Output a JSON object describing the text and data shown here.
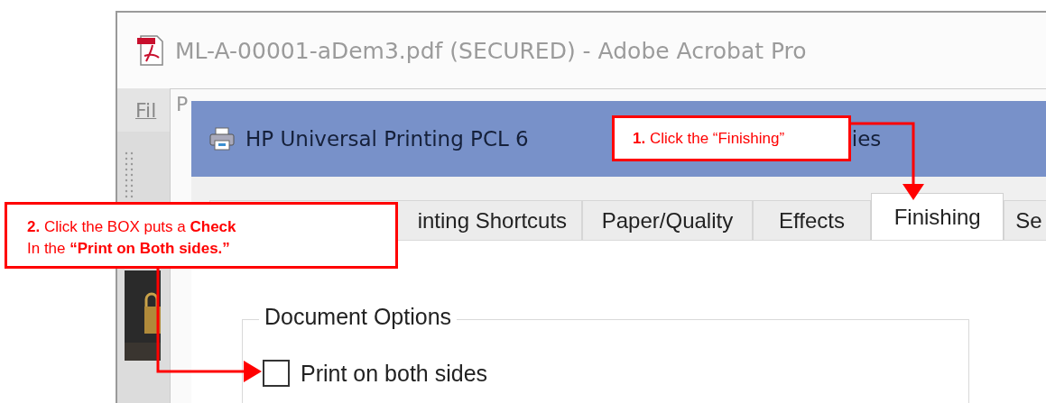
{
  "background_window": {
    "title": "ML-A-00001-aDem3.pdf (SECURED) - Adobe Acrobat Pro",
    "menu": [
      "Fil"
    ]
  },
  "print_window": {
    "title": "P"
  },
  "dialog": {
    "title_parts": [
      "HP Universal Printing PCL 6",
      "ies"
    ],
    "tabs": [
      {
        "label": "inting Shortcuts",
        "selected": false
      },
      {
        "label": "Paper/Quality",
        "selected": false
      },
      {
        "label": "Effects",
        "selected": false
      },
      {
        "label": "Finishing",
        "selected": true
      },
      {
        "label": "Se",
        "selected": false
      }
    ],
    "group": {
      "title": "Document Options",
      "options": [
        {
          "label": "Print on both sides",
          "checked": false
        }
      ]
    }
  },
  "callouts": [
    {
      "lines": [
        "**1.** Click the “Finishing”"
      ]
    },
    {
      "lines": [
        "**2.** Click the BOX puts a **Check**",
        "In the **“Print on Both sides.”**"
      ]
    }
  ]
}
